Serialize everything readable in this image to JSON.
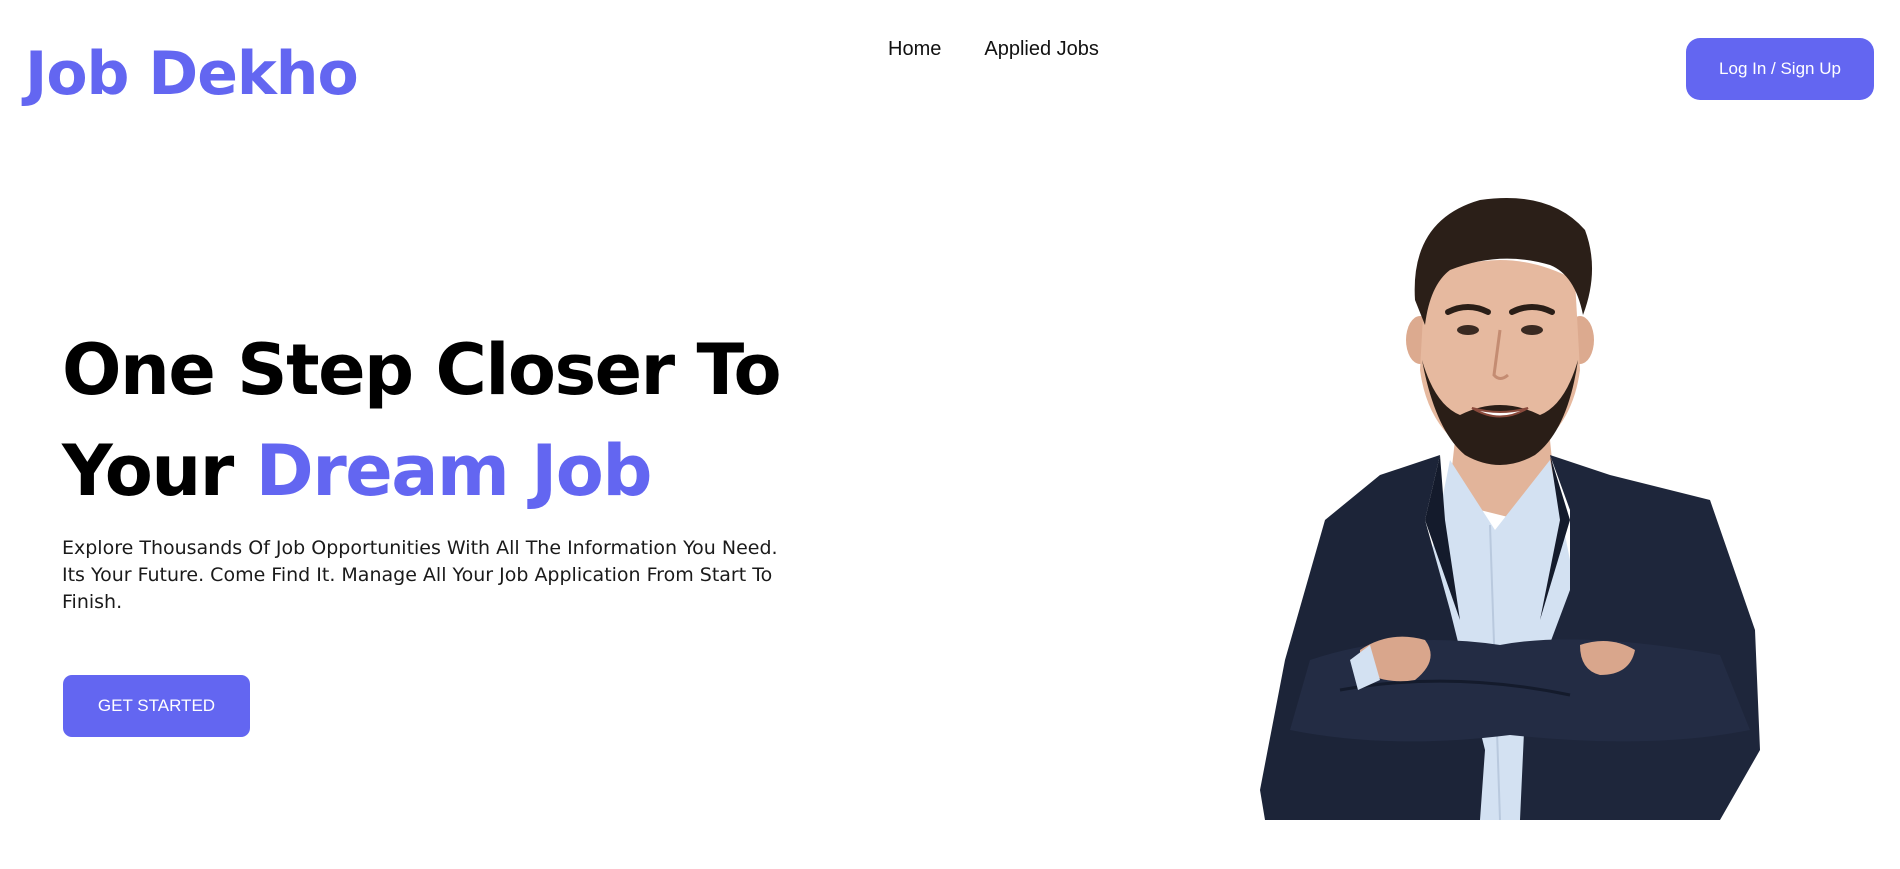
{
  "header": {
    "logo": "Job Dekho",
    "nav": [
      {
        "label": "Home"
      },
      {
        "label": "Applied Jobs"
      }
    ],
    "login_label": "Log In / Sign Up"
  },
  "hero": {
    "title_line1": "One Step Closer To",
    "title_line2_prefix": "Your ",
    "title_line2_accent": "Dream Job",
    "description": "Explore Thousands Of Job Opportunities With All The Information You Need. Its Your Future. Come Find It. Manage All Your Job Application From Start To Finish.",
    "cta_label": "GET STARTED"
  },
  "image": {
    "subject": "smiling man with beard in navy blazer, arms crossed"
  },
  "colors": {
    "accent": "#6366f1",
    "text": "#000000",
    "background": "#ffffff"
  }
}
